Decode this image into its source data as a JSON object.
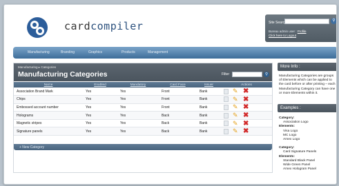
{
  "header": {
    "brand_part1": "card",
    "brand_part2": "compiler",
    "site_search_label": "Site Search",
    "site_search_value": "",
    "user_prefix": "Bureau admin user : ",
    "profile_link": "Profile",
    "logout_link": "Click here to Logout"
  },
  "nav": [
    "Manufacturing",
    "Branding",
    "Graphics",
    "Products",
    "Management"
  ],
  "main": {
    "breadcrumb": [
      "Manufacturing",
      "Categories"
    ],
    "title": "Manufacturing Categories",
    "filter_label": "Filter",
    "filter_value": "",
    "columns": [
      "Name",
      "Enabled",
      "Mandatory",
      "Card Face",
      "Issuer",
      "Actions"
    ],
    "rows": [
      [
        "Association Brand Mark",
        "Yes",
        "Yes",
        "Front",
        "Bank"
      ],
      [
        "Chips",
        "Yes",
        "Yes",
        "Front",
        "Bank"
      ],
      [
        "Embossed account number",
        "Yes",
        "Yes",
        "Front",
        "Bank"
      ],
      [
        "Holograms",
        "Yes",
        "Yes",
        "Back",
        "Bank"
      ],
      [
        "Magnetic stripes",
        "Yes",
        "Yes",
        "Back",
        "Bank"
      ],
      [
        "Signature panels",
        "Yes",
        "Yes",
        "Back",
        "Bank"
      ]
    ],
    "new_link": "+ New Category"
  },
  "sidebar": {
    "more_info_title": "More Info :",
    "more_info_text": "Manufacturing Categories are groups of Elements which can be applied to the card before or after printing – each Manufacturing Category can have one or more Elements within it.",
    "examples_title": "Examples :",
    "examples": [
      {
        "category_label": "Category:",
        "category": "Association Logo",
        "elements_label": "Elements:",
        "elements": [
          "Visa Logo",
          "MC Logo",
          "Amex Logo"
        ]
      },
      {
        "category_label": "Category:",
        "category": "Card Signature Panels",
        "elements_label": "Elements:",
        "elements": [
          "Standard Black Panel",
          "Wide Green Panel",
          "Amex Hologram Panel"
        ]
      }
    ]
  }
}
